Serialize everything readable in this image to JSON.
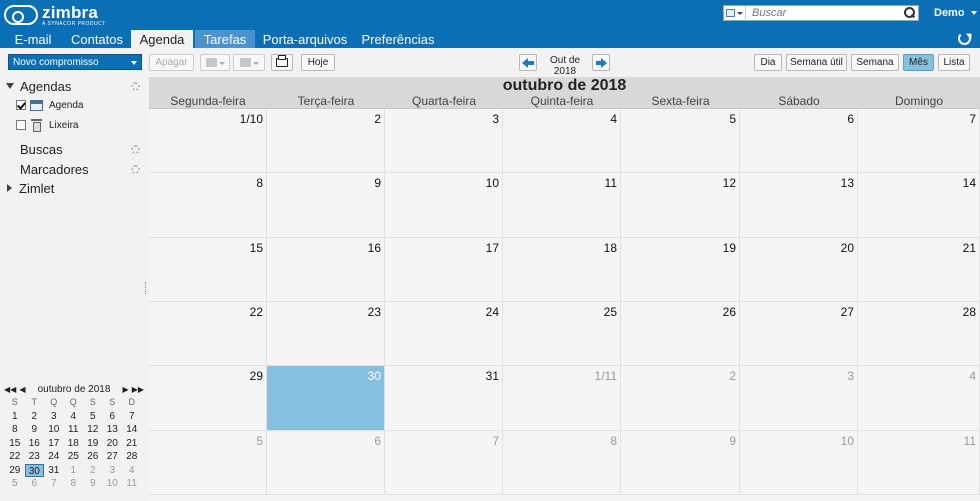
{
  "brand": {
    "name": "zimbra",
    "tagline": "A SYNACOR PRODUCT"
  },
  "search": {
    "placeholder": "Buscar"
  },
  "user": {
    "name": "Demo"
  },
  "tabs": [
    {
      "label": "E-mail",
      "state": "normal"
    },
    {
      "label": "Contatos",
      "state": "normal"
    },
    {
      "label": "Agenda",
      "state": "active"
    },
    {
      "label": "Tarefas",
      "state": "hover"
    },
    {
      "label": "Porta-arquivos",
      "state": "normal"
    },
    {
      "label": "Preferências",
      "state": "normal"
    }
  ],
  "toolbar": {
    "new_label": "Novo compromisso",
    "delete_label": "Apagar",
    "today_label": "Hoje",
    "range_label": "Out de 2018",
    "views": [
      {
        "label": "Dia",
        "selected": false
      },
      {
        "label": "Semana útil",
        "selected": false
      },
      {
        "label": "Semana",
        "selected": false
      },
      {
        "label": "Mês",
        "selected": true
      },
      {
        "label": "Lista",
        "selected": false
      }
    ]
  },
  "sidebar": {
    "calendars_header": "Agendas",
    "calendars": [
      {
        "label": "Agenda",
        "checked": true,
        "icon": "calendar-icon"
      },
      {
        "label": "Lixeira",
        "checked": false,
        "icon": "trash-icon"
      }
    ],
    "searches_label": "Buscas",
    "tags_label": "Marcadores",
    "zimlets_label": "Zimlet"
  },
  "mini_calendar": {
    "title": "outubro de 2018",
    "weekdays": [
      "S",
      "T",
      "Q",
      "Q",
      "S",
      "S",
      "D"
    ],
    "weeks": [
      [
        "1",
        "2",
        "3",
        "4",
        "5",
        "6",
        "7"
      ],
      [
        "8",
        "9",
        "10",
        "11",
        "12",
        "13",
        "14"
      ],
      [
        "15",
        "16",
        "17",
        "18",
        "19",
        "20",
        "21"
      ],
      [
        "22",
        "23",
        "24",
        "25",
        "26",
        "27",
        "28"
      ],
      [
        "29",
        "30",
        "31",
        "1",
        "2",
        "3",
        "4"
      ],
      [
        "5",
        "6",
        "7",
        "8",
        "9",
        "10",
        "11"
      ]
    ],
    "today": "30"
  },
  "month_view": {
    "title": "outubro de 2018",
    "weekdays": [
      "Segunda-feira",
      "Terça-feira",
      "Quarta-feira",
      "Quinta-feira",
      "Sexta-feira",
      "Sábado",
      "Domingo"
    ],
    "weeks": [
      [
        "1/10",
        "2",
        "3",
        "4",
        "5",
        "6",
        "7"
      ],
      [
        "8",
        "9",
        "10",
        "11",
        "12",
        "13",
        "14"
      ],
      [
        "15",
        "16",
        "17",
        "18",
        "19",
        "20",
        "21"
      ],
      [
        "22",
        "23",
        "24",
        "25",
        "26",
        "27",
        "28"
      ],
      [
        "29",
        "30",
        "31",
        "1/11",
        "2",
        "3",
        "4"
      ],
      [
        "5",
        "6",
        "7",
        "8",
        "9",
        "10",
        "11"
      ]
    ],
    "today": "30"
  }
}
